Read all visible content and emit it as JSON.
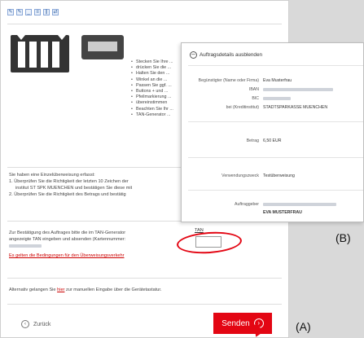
{
  "instructions": [
    "Stecken Sie Ihre ...",
    "drücken Sie die ...",
    "Halten Sie den ...",
    "Winkel an die ...",
    "Passen Sie ggf. ...",
    "Buttons + und ...",
    "Pfeilmarkierung ...",
    "übereinstimmen",
    "Beachten Sie Ihr ...",
    "TAN-Generator ..."
  ],
  "single_transfer_text": "Sie haben eine Einzelüberweisung erfasst:",
  "step1_a": "1. Überprüfen Sie die Richtigkeit der letzten 10 Zeichen der",
  "step1_b": "institut ST SPK MUENCHEN und bestätigen Sie diese mit",
  "step2": "2. Überprüfen Sie die Richtigkeit des Betrags und bestätig",
  "confirm_a": "Zur Bestätigung des Auftrages bitte die im TAN-Generator",
  "confirm_b": "angezeigte TAN eingeben und absenden (Kartennummer:",
  "conditions_link": "Es gelten die Bedingungen für den Überweisungsverkehr",
  "tan_label": "TAN",
  "alt_text_pre": "Alternativ gelangen Sie ",
  "alt_link": "hier",
  "alt_text_post": " zur manuellen Eingabe über die Gerätetastatur.",
  "back_label": "Zurück",
  "send_label": "Senden",
  "label_a": "(A)",
  "label_b": "(B)",
  "panel": {
    "title": "Auftragsdetails ausblenden",
    "beneficiary_label": "Begünstigter (Name oder Firma)",
    "beneficiary_value": "Eva Musterfrau",
    "iban_label": "IBAN",
    "bic_label": "BIC",
    "bank_label": "bei (Kreditinstitut)",
    "bank_value": "STADTSPARKASSE MUENCHEN",
    "amount_label": "Betrag",
    "amount_value": "6,50 EUR",
    "purpose_label": "Verwendungszweck",
    "purpose_value": "Testüberweisung",
    "payer_label": "Auftraggeber",
    "payer_name": "EVA MUSTERFRAU"
  },
  "colors": {
    "accent": "#e30613"
  }
}
